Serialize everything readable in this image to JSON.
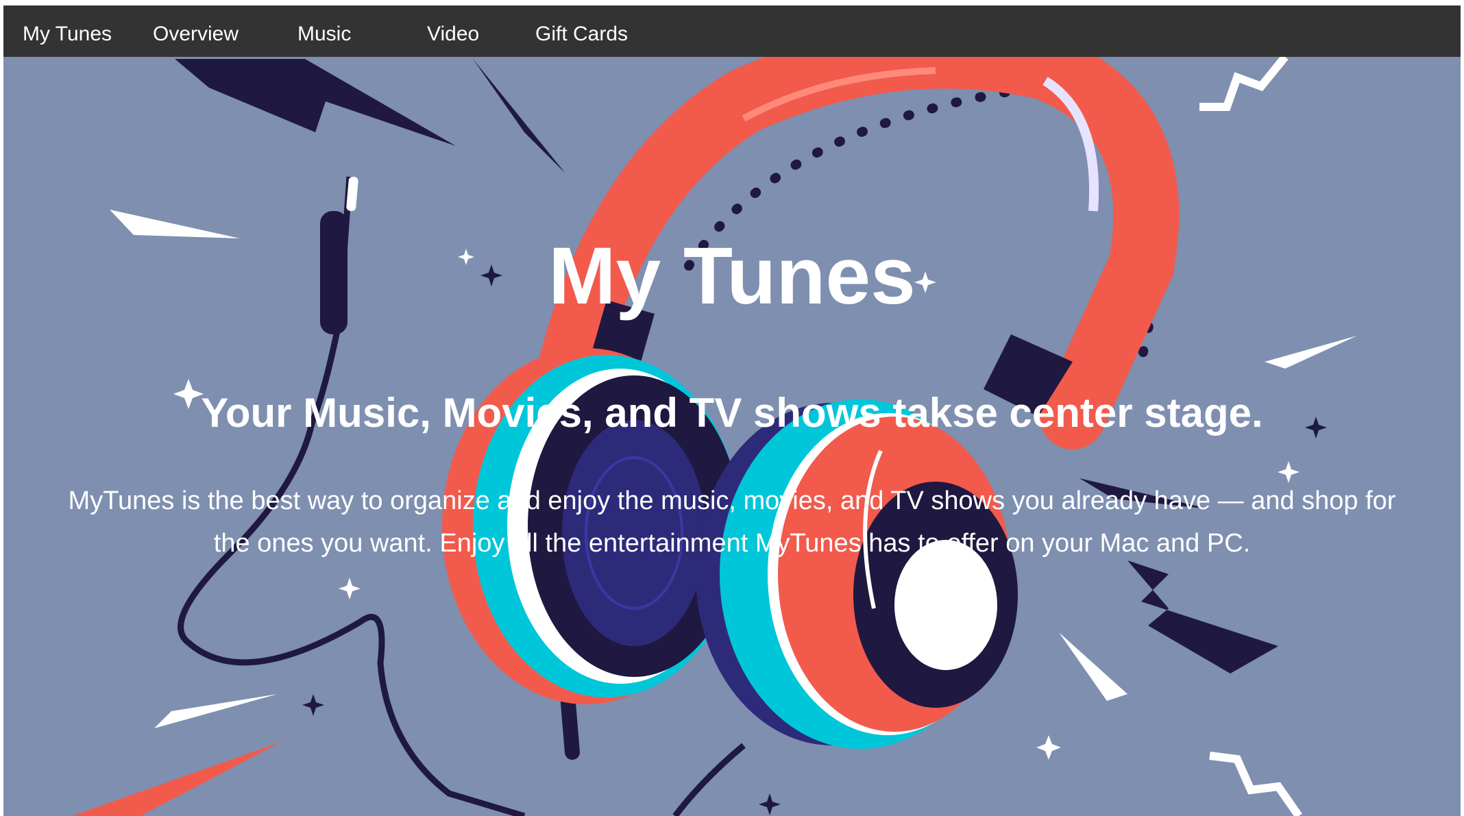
{
  "nav": {
    "brand": "My Tunes",
    "items": [
      {
        "label": "Overview"
      },
      {
        "label": "Music"
      },
      {
        "label": "Video"
      },
      {
        "label": "Gift Cards"
      }
    ]
  },
  "hero": {
    "title": "My Tunes",
    "subtitle": "Your Music, Movies, and TV shows takse center stage.",
    "description": "MyTunes is the best way to organize and enjoy the music, movies, and TV shows you already have — and shop for the ones you want. Enjoy all the entertainment MyTunes has to offer on your Mac and PC.",
    "image": "headphones-illustration"
  },
  "colors": {
    "navbar": "#333333",
    "nav_text": "#ffffff",
    "hero_background": "#7e8fb0",
    "headphone_band": "#f25a4c",
    "ear_cup_ring": "#00c6d9",
    "ear_cup_dark": "#1f1840",
    "ear_cup_inner": "#2e2a7a",
    "hero_text": "#ffffff"
  }
}
